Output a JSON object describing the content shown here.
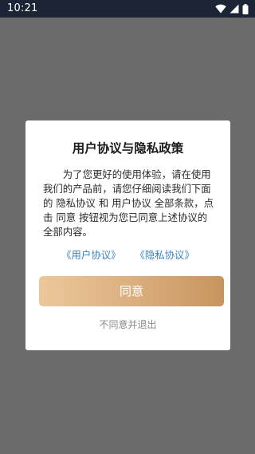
{
  "status_bar": {
    "time": "10:21",
    "icons": [
      "wifi-icon",
      "cellular-signal-icon",
      "battery-icon"
    ]
  },
  "dialog": {
    "title": "用户协议与隐私政策",
    "body": "为了您更好的使用体验，请在使用我们的产品前，请您仔细阅读我们下面的 隐私协议 和 用户协议 全部条款，点击 同意 按钮视为您已同意上述协议的全部内容。",
    "links": {
      "user_agreement": "《用户协议》",
      "privacy_agreement": "《隐私协议》"
    },
    "agree_label": "同意",
    "decline_label": "不同意并退出"
  },
  "colors": {
    "status_bar": "#1b2536",
    "overlay": "#6b6b6b",
    "link": "#3b82c4",
    "button_gradient_start": "#ecc79a",
    "button_gradient_end": "#c7945d"
  }
}
